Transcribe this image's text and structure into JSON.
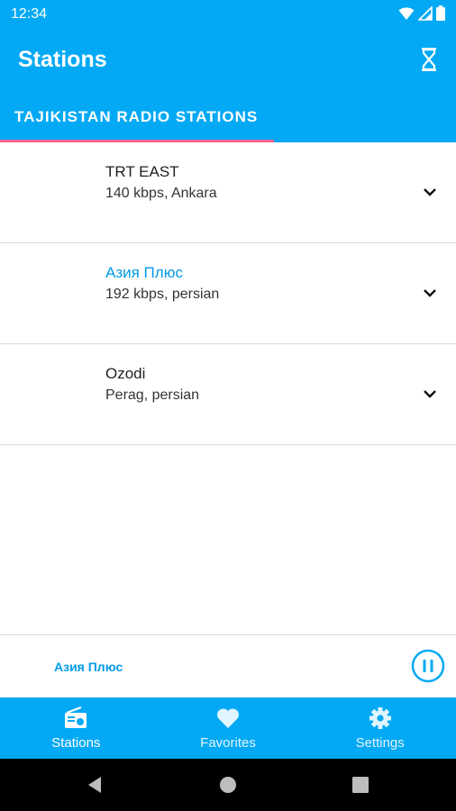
{
  "status_bar": {
    "time": "12:34",
    "icons": [
      "wifi-icon",
      "signal-icon",
      "battery-icon"
    ]
  },
  "app_bar": {
    "title": "Stations",
    "timer_icon": "hourglass-icon"
  },
  "tab": {
    "label": "TAJIKISTAN RADIO STATIONS"
  },
  "stations": [
    {
      "name": "TRT EAST",
      "info": "140 kbps, Ankara",
      "active": false
    },
    {
      "name": "Азия Плюс",
      "info": "192 kbps, persian",
      "active": true
    },
    {
      "name": "Ozodi",
      "info": "Perag, persian",
      "active": false
    }
  ],
  "player": {
    "now_playing": "Азия Плюс",
    "control_icon": "pause-icon"
  },
  "bottom_nav": {
    "items": [
      {
        "label": "Stations",
        "icon": "radio-icon",
        "selected": true
      },
      {
        "label": "Favorites",
        "icon": "heart-icon",
        "selected": false
      },
      {
        "label": "Settings",
        "icon": "gear-icon",
        "selected": false
      }
    ]
  },
  "colors": {
    "primary": "#03a9f4",
    "accent_indicator": "#f06292",
    "active_text": "#039be5"
  }
}
